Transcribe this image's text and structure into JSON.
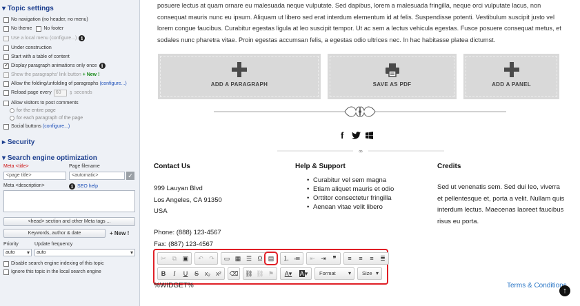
{
  "sidebar": {
    "topic_settings": "Topic settings",
    "options": [
      {
        "label": "No navigation (no header, no menu)",
        "checked": false
      },
      {
        "label": "No theme",
        "checked": false
      },
      {
        "label": "No footer",
        "checked": false
      },
      {
        "label": "Use a local menu",
        "link": "(configure...)",
        "checked": false,
        "disabled": true
      },
      {
        "label": "Under construction",
        "checked": false
      },
      {
        "label": "Start with a table of content",
        "checked": false
      },
      {
        "label": "Display paragraph animations only once",
        "checked": true
      },
      {
        "label": "Show the paragraphs' link button",
        "new": "+ New !",
        "checked": false,
        "disabled": true
      },
      {
        "label": "Allow the folding/unfolding of paragraphs",
        "link": "(configure...)",
        "checked": false
      },
      {
        "label": "Reload page every",
        "value": "60",
        "unit": "seconds",
        "checked": false
      },
      {
        "label": "Allow visitors to post comments",
        "checked": false
      },
      {
        "label": "for the entire page"
      },
      {
        "label": "for each paragraph of the page"
      },
      {
        "label": "Social buttons",
        "link": "(configure...)",
        "checked": false
      }
    ],
    "security": "Security",
    "seo": "Search engine optimization",
    "meta_title_label": "Meta <title>",
    "meta_title_placeholder": "<page title>",
    "page_filename_label": "Page filename",
    "page_filename_value": "<automatic>",
    "meta_description_label": "Meta <description>",
    "seo_help": "SEO help",
    "head_section_button": "<head> section and other Meta tags ...",
    "keywords_button": "Keywords, author & date",
    "keywords_new": "+ New !",
    "priority_label": "Priority",
    "priority_value": "auto",
    "update_freq_label": "Update frequency",
    "update_freq_value": "auto",
    "disable_indexing": "Disable search engine indexing of this topic",
    "ignore_local_search": "Ignore this topic in the local search engine"
  },
  "main": {
    "body_text": "posuere lectus at quam ornare eu malesuada neque vulputate. Sed dapibus, lorem a malesuada fringilla, neque orci vulputate lacus, non consequat mauris nunc eu ipsum. Aliquam ut libero sed erat interdum elementum id at felis. Suspendisse potenti. Vestibulum suscipit justo vel lorem congue faucibus. Curabitur egestas ligula at leo suscipit tempor. Ut ac sem a lectus vehicula egestas. Fusce posuere consequat metus, et sodales nunc pharetra vitae. Proin egestas accumsan felis, a egestas odio ultrices nec. In hac habitasse platea dictumst.",
    "add_paragraph": "ADD A PARAGRAPH",
    "save_pdf": "SAVE AS PDF",
    "add_panel": "ADD A PANEL",
    "social_icons": [
      "facebook-icon",
      "twitter-icon",
      "windows-icon"
    ],
    "contact": {
      "title": "Contact Us",
      "address1": "999 Lauyan Blvd",
      "address2": "Los Angeles, CA 91350",
      "country": "USA",
      "phone": "Phone: (888) 123-4567",
      "fax": "Fax: (887) 123-4567"
    },
    "help": {
      "title": "Help & Support",
      "items": [
        "Curabitur vel sem magna",
        "Etiam aliquet mauris et odio",
        "Orttitor consectetur fringilla",
        "Aenean vitae velit libero"
      ]
    },
    "credits": {
      "title": "Credits",
      "text": "Sed ut venenatis sem. Sed dui leo, viverra et pellentesque et, porta a velit. Nullam quis interdum lectus. Maecenas laoreet faucibus risus eu porta."
    },
    "toolbar": {
      "format_label": "Format",
      "size_label": "Size"
    },
    "widget": "%WIDGET%",
    "terms": "Terms & Conditions",
    "accent_color": "#e01f26"
  }
}
